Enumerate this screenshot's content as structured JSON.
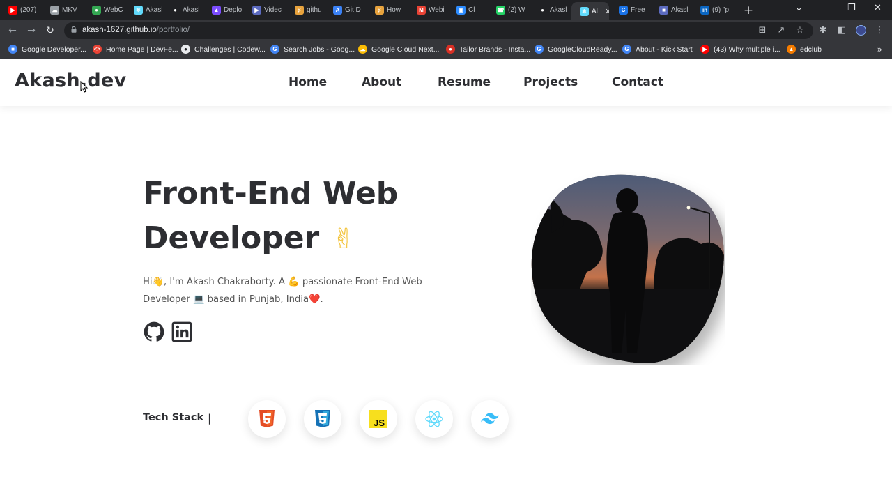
{
  "browser": {
    "tabs": [
      {
        "label": "(207)",
        "icon": "youtube-icon",
        "color": "#ff0000"
      },
      {
        "label": "MKV",
        "icon": "cloud-icon",
        "color": "#9aa0a6"
      },
      {
        "label": "WebC",
        "icon": "dot-icon",
        "color": "#34a853"
      },
      {
        "label": "Akasl",
        "icon": "react-icon",
        "color": "#61dafb"
      },
      {
        "label": "Akasl",
        "icon": "github-icon",
        "color": "#ffffff"
      },
      {
        "label": "Deplo",
        "icon": "deploy-icon",
        "color": "#7c4dff"
      },
      {
        "label": "Videc",
        "icon": "video-icon",
        "color": "#5c6bc0"
      },
      {
        "label": "githu",
        "icon": "bookmark-icon",
        "color": "#e8a33d"
      },
      {
        "label": "Git D",
        "icon": "a-icon",
        "color": "#3b82f6"
      },
      {
        "label": "How",
        "icon": "bookmark-icon",
        "color": "#e8a33d"
      },
      {
        "label": "Webi",
        "icon": "gmail-icon",
        "color": "#ea4335"
      },
      {
        "label": "Cl",
        "icon": "zoom-icon",
        "color": "#2d8cff"
      },
      {
        "label": "(2) W",
        "icon": "whatsapp-icon",
        "color": "#25d366"
      },
      {
        "label": "Akasl",
        "icon": "github-icon",
        "color": "#ffffff"
      },
      {
        "label": "Al",
        "icon": "react-icon",
        "color": "#61dafb"
      },
      {
        "label": "Free",
        "icon": "c-icon",
        "color": "#1a73e8"
      },
      {
        "label": "Akasl",
        "icon": "window-icon",
        "color": "#5c6bc0"
      },
      {
        "label": "(9) \"p",
        "icon": "linkedin-icon",
        "color": "#0a66c2"
      }
    ],
    "url_host": "akash-1627.github.io",
    "url_path": "/portfolio/",
    "bookmarks": [
      {
        "label": "Google Developer...",
        "icon": "google-dev-icon",
        "color": "#4285f4"
      },
      {
        "label": "Home Page | DevFe...",
        "icon": "code-icon",
        "color": "#ea4335"
      },
      {
        "label": "Challenges | Codew...",
        "icon": "codewars-icon",
        "color": "#e8eaed"
      },
      {
        "label": "Search Jobs - Goog...",
        "icon": "google-icon",
        "color": "#4285f4"
      },
      {
        "label": "Google Cloud Next...",
        "icon": "gcloud-icon",
        "color": "#fbbc04"
      },
      {
        "label": "Tailor Brands - Insta...",
        "icon": "tailor-icon",
        "color": "#d93025"
      },
      {
        "label": "GoogleCloudReady...",
        "icon": "google-icon",
        "color": "#4285f4"
      },
      {
        "label": "About - Kick Start",
        "icon": "google-icon",
        "color": "#4285f4"
      },
      {
        "label": "(43) Why multiple i...",
        "icon": "youtube-icon",
        "color": "#ff0000"
      },
      {
        "label": "edclub",
        "icon": "edclub-icon",
        "color": "#f57c00"
      }
    ]
  },
  "site": {
    "logo": "Akash.dev",
    "nav": [
      "Home",
      "About",
      "Resume",
      "Projects",
      "Contact"
    ],
    "hero": {
      "title_line1": "Front-End Web",
      "title_line2": "Developer",
      "intro": "Hi👋, I'm Akash Chakraborty. A 💪 passionate Front-End Web Developer 💻 based in Punjab, India❤️."
    },
    "tech_stack_label": "Tech Stack",
    "tech_stack_separator": "|",
    "tech": [
      {
        "name": "HTML5",
        "icon": "html5-icon",
        "color": "#e44d26"
      },
      {
        "name": "CSS3",
        "icon": "css3-icon",
        "color": "#1572b6"
      },
      {
        "name": "JavaScript",
        "icon": "javascript-icon",
        "color": "#f7df1e",
        "text": "JS"
      },
      {
        "name": "React",
        "icon": "react-icon",
        "color": "#61dafb"
      },
      {
        "name": "Tailwind",
        "icon": "tailwind-icon",
        "color": "#38bdf8"
      }
    ]
  }
}
